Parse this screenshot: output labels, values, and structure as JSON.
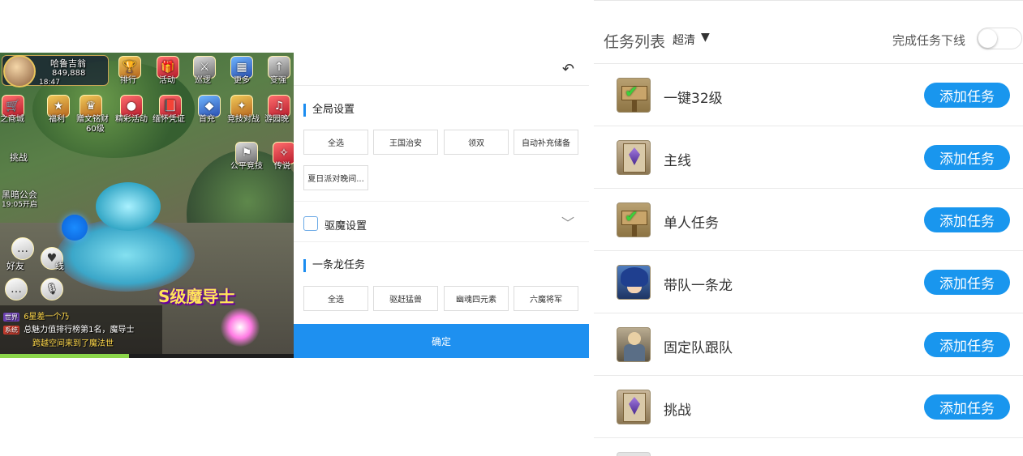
{
  "game": {
    "player_name": "哈鲁吉翁",
    "player_score": "849,888",
    "clock": "18:47",
    "top_icons": [
      "排行",
      "活动",
      "巡逻",
      "更多",
      "变强"
    ],
    "second_icons": [
      "之商城",
      "福利",
      "赠文铭财",
      "精彩活动",
      "缅怀凭证",
      "首充",
      "竞技对战",
      "游园晚"
    ],
    "level_label": "60级",
    "side_labels": [
      "挑战",
      "公平竞技",
      "传说"
    ],
    "guild": "黑暗公会",
    "guild_time": "19:05开启",
    "social": [
      "好友",
      "线"
    ],
    "rank_banner": "S级魔导士",
    "chat": [
      {
        "tag": "世界",
        "text": "6星差一个乃"
      },
      {
        "tag": "系统",
        "text": "总魅力值排行榜第1名，魔导士"
      },
      {
        "tag": "",
        "text": "跨越空间来到了魔法世"
      }
    ],
    "xp_percent": 44
  },
  "panel": {
    "back_icon": "back-arrow-icon",
    "global_title": "全局设置",
    "global_chips": [
      "全选",
      "王国治安",
      "领双",
      "自动补充储备",
      "夏日派对晚间..."
    ],
    "exorcism_label": "驱魔设置",
    "chain_title": "一条龙任务",
    "chain_chips": [
      "全选",
      "驱赶猛兽",
      "幽魂四元素",
      "六魔将军"
    ],
    "confirm_label": "确定"
  },
  "tasks": {
    "title": "任务列表",
    "quality": "超清",
    "quality_arrow": "▼",
    "offline_label": "完成任务下线",
    "offline_enabled": false,
    "add_label": "添加任务",
    "items": [
      {
        "name": "一键32级",
        "icon": "signpost-check-icon"
      },
      {
        "name": "主线",
        "icon": "scroll-gem-icon"
      },
      {
        "name": "单人任务",
        "icon": "signpost-check-icon"
      },
      {
        "name": "带队一条龙",
        "icon": "blue-hair-hero-icon"
      },
      {
        "name": "固定队跟队",
        "icon": "team-member-icon"
      },
      {
        "name": "挑战",
        "icon": "scroll-gem-icon"
      }
    ],
    "accent_color": "#1996ee"
  }
}
